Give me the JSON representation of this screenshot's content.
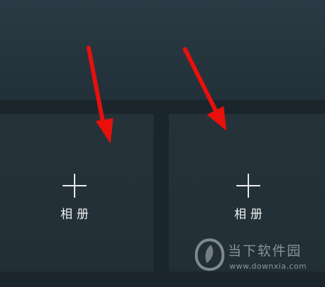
{
  "tiles": [
    {
      "label": "相册",
      "icon": "plus-icon"
    },
    {
      "label": "相册",
      "icon": "plus-icon"
    }
  ],
  "watermark": {
    "text": "当下软件园",
    "url": "www.downxia.com"
  },
  "colors": {
    "arrow": "#e8100c",
    "tile_bg": "#253239",
    "page_bg": "#1b262c"
  }
}
